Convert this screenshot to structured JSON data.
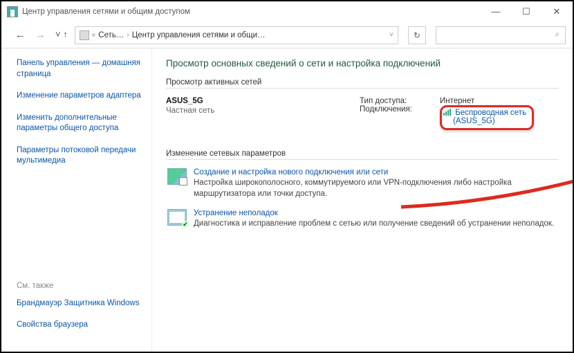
{
  "window": {
    "title": "Центр управления сетями и общим доступом"
  },
  "breadcrumb": {
    "root": "Сеть…",
    "current": "Центр управления сетями и общи…"
  },
  "sidebar": {
    "links": [
      "Панель управления — домашняя страница",
      "Изменение параметров адаптера",
      "Изменить дополнительные параметры общего доступа",
      "Параметры потоковой передачи мультимедиа"
    ],
    "see_also_label": "См. также",
    "see_also": [
      "Брандмауэр Защитника Windows",
      "Свойства браузера"
    ]
  },
  "main": {
    "heading": "Просмотр основных сведений о сети и настройка подключений",
    "active_section": "Просмотр активных сетей",
    "network": {
      "name": "ASUS_5G",
      "type": "Частная сеть"
    },
    "access": {
      "label": "Тип доступа:",
      "value": "Интернет"
    },
    "connections": {
      "label": "Подключения:",
      "link_line1": "Беспроводная сеть",
      "link_line2": "(ASUS_5G)"
    },
    "change_section": "Изменение сетевых параметров",
    "task1": {
      "title": "Создание и настройка нового подключения или сети",
      "desc": "Настройка широкополосного, коммутируемого или VPN-подключения либо настройка маршрутизатора или точки доступа."
    },
    "task2": {
      "title": "Устранение неполадок",
      "desc": "Диагностика и исправление проблем с сетью или получение сведений об устранении неполадок."
    }
  }
}
